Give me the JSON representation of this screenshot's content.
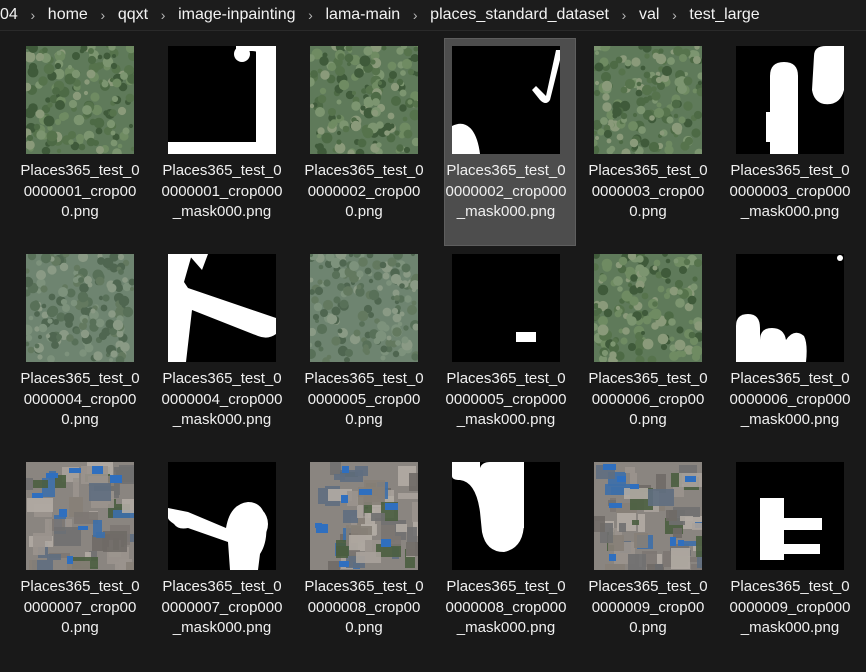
{
  "breadcrumb": {
    "items": [
      "04",
      "home",
      "qqxt",
      "image-inpainting",
      "lama-main",
      "places_standard_dataset",
      "val",
      "test_large"
    ]
  },
  "colors": {
    "background": "#191919",
    "selection": "#4d4d4d",
    "text": "#f0f0f0",
    "separator": "#b8b8b8"
  },
  "files": [
    {
      "name": "Places365_test_00000001_crop000.png",
      "kind": "photo",
      "variant": "forest",
      "selected": false
    },
    {
      "name": "Places365_test_00000001_crop000_mask000.png",
      "kind": "mask",
      "variant": "m1",
      "selected": false
    },
    {
      "name": "Places365_test_00000002_crop000.png",
      "kind": "photo",
      "variant": "forest",
      "selected": false
    },
    {
      "name": "Places365_test_00000002_crop000_mask000.png",
      "kind": "mask",
      "variant": "m2",
      "selected": true
    },
    {
      "name": "Places365_test_00000003_crop000.png",
      "kind": "photo",
      "variant": "forest",
      "selected": false
    },
    {
      "name": "Places365_test_00000003_crop000_mask000.png",
      "kind": "mask",
      "variant": "m3",
      "selected": false
    },
    {
      "name": "Places365_test_00000004_crop000.png",
      "kind": "photo",
      "variant": "forest-pale",
      "selected": false
    },
    {
      "name": "Places365_test_00000004_crop000_mask000.png",
      "kind": "mask",
      "variant": "m4",
      "selected": false
    },
    {
      "name": "Places365_test_00000005_crop000.png",
      "kind": "photo",
      "variant": "forest-pale",
      "selected": false
    },
    {
      "name": "Places365_test_00000005_crop000_mask000.png",
      "kind": "mask",
      "variant": "m5",
      "selected": false
    },
    {
      "name": "Places365_test_00000006_crop000.png",
      "kind": "photo",
      "variant": "forest",
      "selected": false
    },
    {
      "name": "Places365_test_00000006_crop000_mask000.png",
      "kind": "mask",
      "variant": "m6",
      "selected": false
    },
    {
      "name": "Places365_test_00000007_crop000.png",
      "kind": "photo",
      "variant": "village",
      "selected": false
    },
    {
      "name": "Places365_test_00000007_crop000_mask000.png",
      "kind": "mask",
      "variant": "m7",
      "selected": false
    },
    {
      "name": "Places365_test_00000008_crop000.png",
      "kind": "photo",
      "variant": "village",
      "selected": false
    },
    {
      "name": "Places365_test_00000008_crop000_mask000.png",
      "kind": "mask",
      "variant": "m8",
      "selected": false
    },
    {
      "name": "Places365_test_00000009_crop000.png",
      "kind": "photo",
      "variant": "village",
      "selected": false
    },
    {
      "name": "Places365_test_00000009_crop000_mask000.png",
      "kind": "mask",
      "variant": "m9",
      "selected": false
    }
  ]
}
